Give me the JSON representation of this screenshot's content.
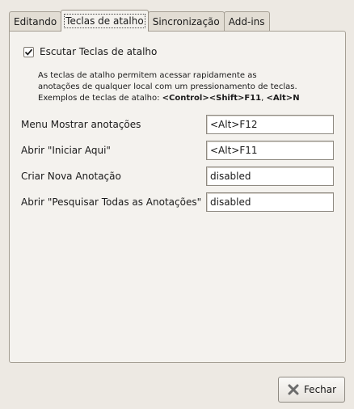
{
  "tabs": [
    {
      "label": "Editando",
      "active": false
    },
    {
      "label": "Teclas de atalho",
      "active": true
    },
    {
      "label": "Sincronização",
      "active": false
    },
    {
      "label": "Add-ins",
      "active": false
    }
  ],
  "listen": {
    "label": "Escutar Teclas de atalho",
    "checked": true
  },
  "description": {
    "line1": "As teclas de atalho permitem acessar rapidamente as",
    "line2": "anotações de qualquer local com um pressionamento de teclas.",
    "line3_prefix": "Exemplos de teclas de atalho: ",
    "line3_example1": "<Control><Shift>F11",
    "line3_sep": ", ",
    "line3_example2": "<Alt>N"
  },
  "shortcuts": [
    {
      "label": "Menu Mostrar anotações",
      "value": "<Alt>F12"
    },
    {
      "label": "Abrir \"Iniciar Aqui\"",
      "value": "<Alt>F11"
    },
    {
      "label": "Criar Nova Anotação",
      "value": "disabled"
    },
    {
      "label": "Abrir \"Pesquisar Todas as Anotações\"",
      "value": "disabled"
    }
  ],
  "close_button": {
    "label": "Fechar",
    "icon": "close-icon"
  },
  "colors": {
    "background": "#ede9e3",
    "panel": "#f4f2ee",
    "close_icon": "#6b6b6b"
  }
}
